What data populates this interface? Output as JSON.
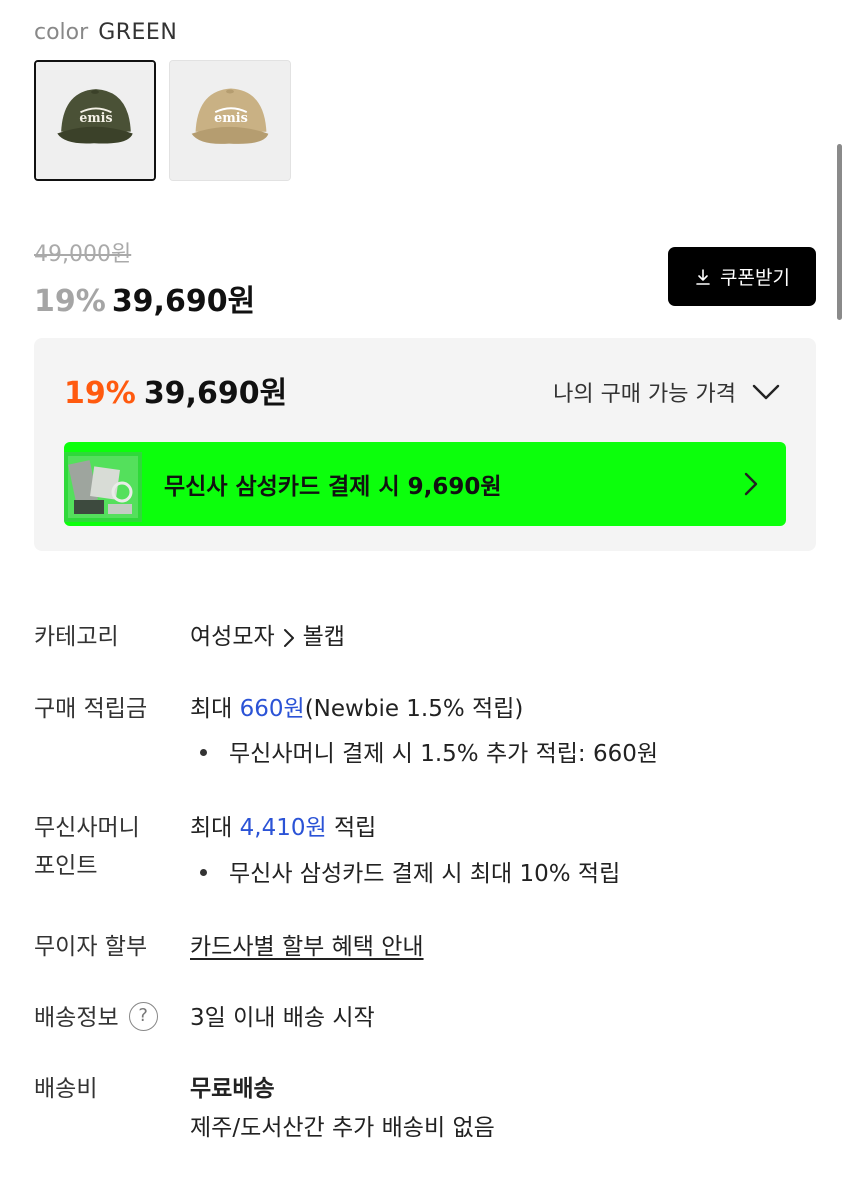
{
  "color_option": {
    "label": "color",
    "value": "GREEN",
    "swatches": [
      {
        "name": "green",
        "logo": "emis",
        "color": "#4a5136",
        "selected": true
      },
      {
        "name": "beige",
        "logo": "emis",
        "color": "#c9b184",
        "selected": false
      }
    ]
  },
  "price": {
    "original": "49,000원",
    "discount": "19%",
    "sale": "39,690원"
  },
  "coupon_button": {
    "label": "쿠폰받기",
    "icon": "download-icon"
  },
  "my_price": {
    "discount": "19%",
    "amount": "39,690원",
    "toggle_label": "나의 구매 가능 가격",
    "card_banner": {
      "text_prefix": "무신사 삼성카드 결제 시 ",
      "text_amount": "9,690원"
    }
  },
  "info": {
    "category": {
      "label": "카테고리",
      "path": [
        "여성모자",
        "볼캡"
      ]
    },
    "points": {
      "label": "구매 적립금",
      "prefix": "최대 ",
      "amount": "660원",
      "suffix": "(Newbie 1.5% 적립)",
      "bullet": "무신사머니 결제 시 1.5% 추가 적립: 660원"
    },
    "money_points": {
      "label_line1": "무신사머니",
      "label_line2": "포인트",
      "prefix": "최대 ",
      "amount": "4,410원",
      "suffix": " 적립",
      "bullet": "무신사 삼성카드 결제 시 최대 10% 적립"
    },
    "installment": {
      "label": "무이자 할부",
      "link": "카드사별 할부 혜택 안내"
    },
    "shipping_info": {
      "label": "배송정보",
      "help": "?",
      "value": "3일 이내 배송 시작"
    },
    "shipping_fee": {
      "label": "배송비",
      "value": "무료배송",
      "note": "제주/도서산간 추가 배송비 없음"
    }
  },
  "colors": {
    "discount_orange": "#ff5a0f",
    "link_blue": "#2b53d6",
    "banner_green": "#0cff0c"
  }
}
